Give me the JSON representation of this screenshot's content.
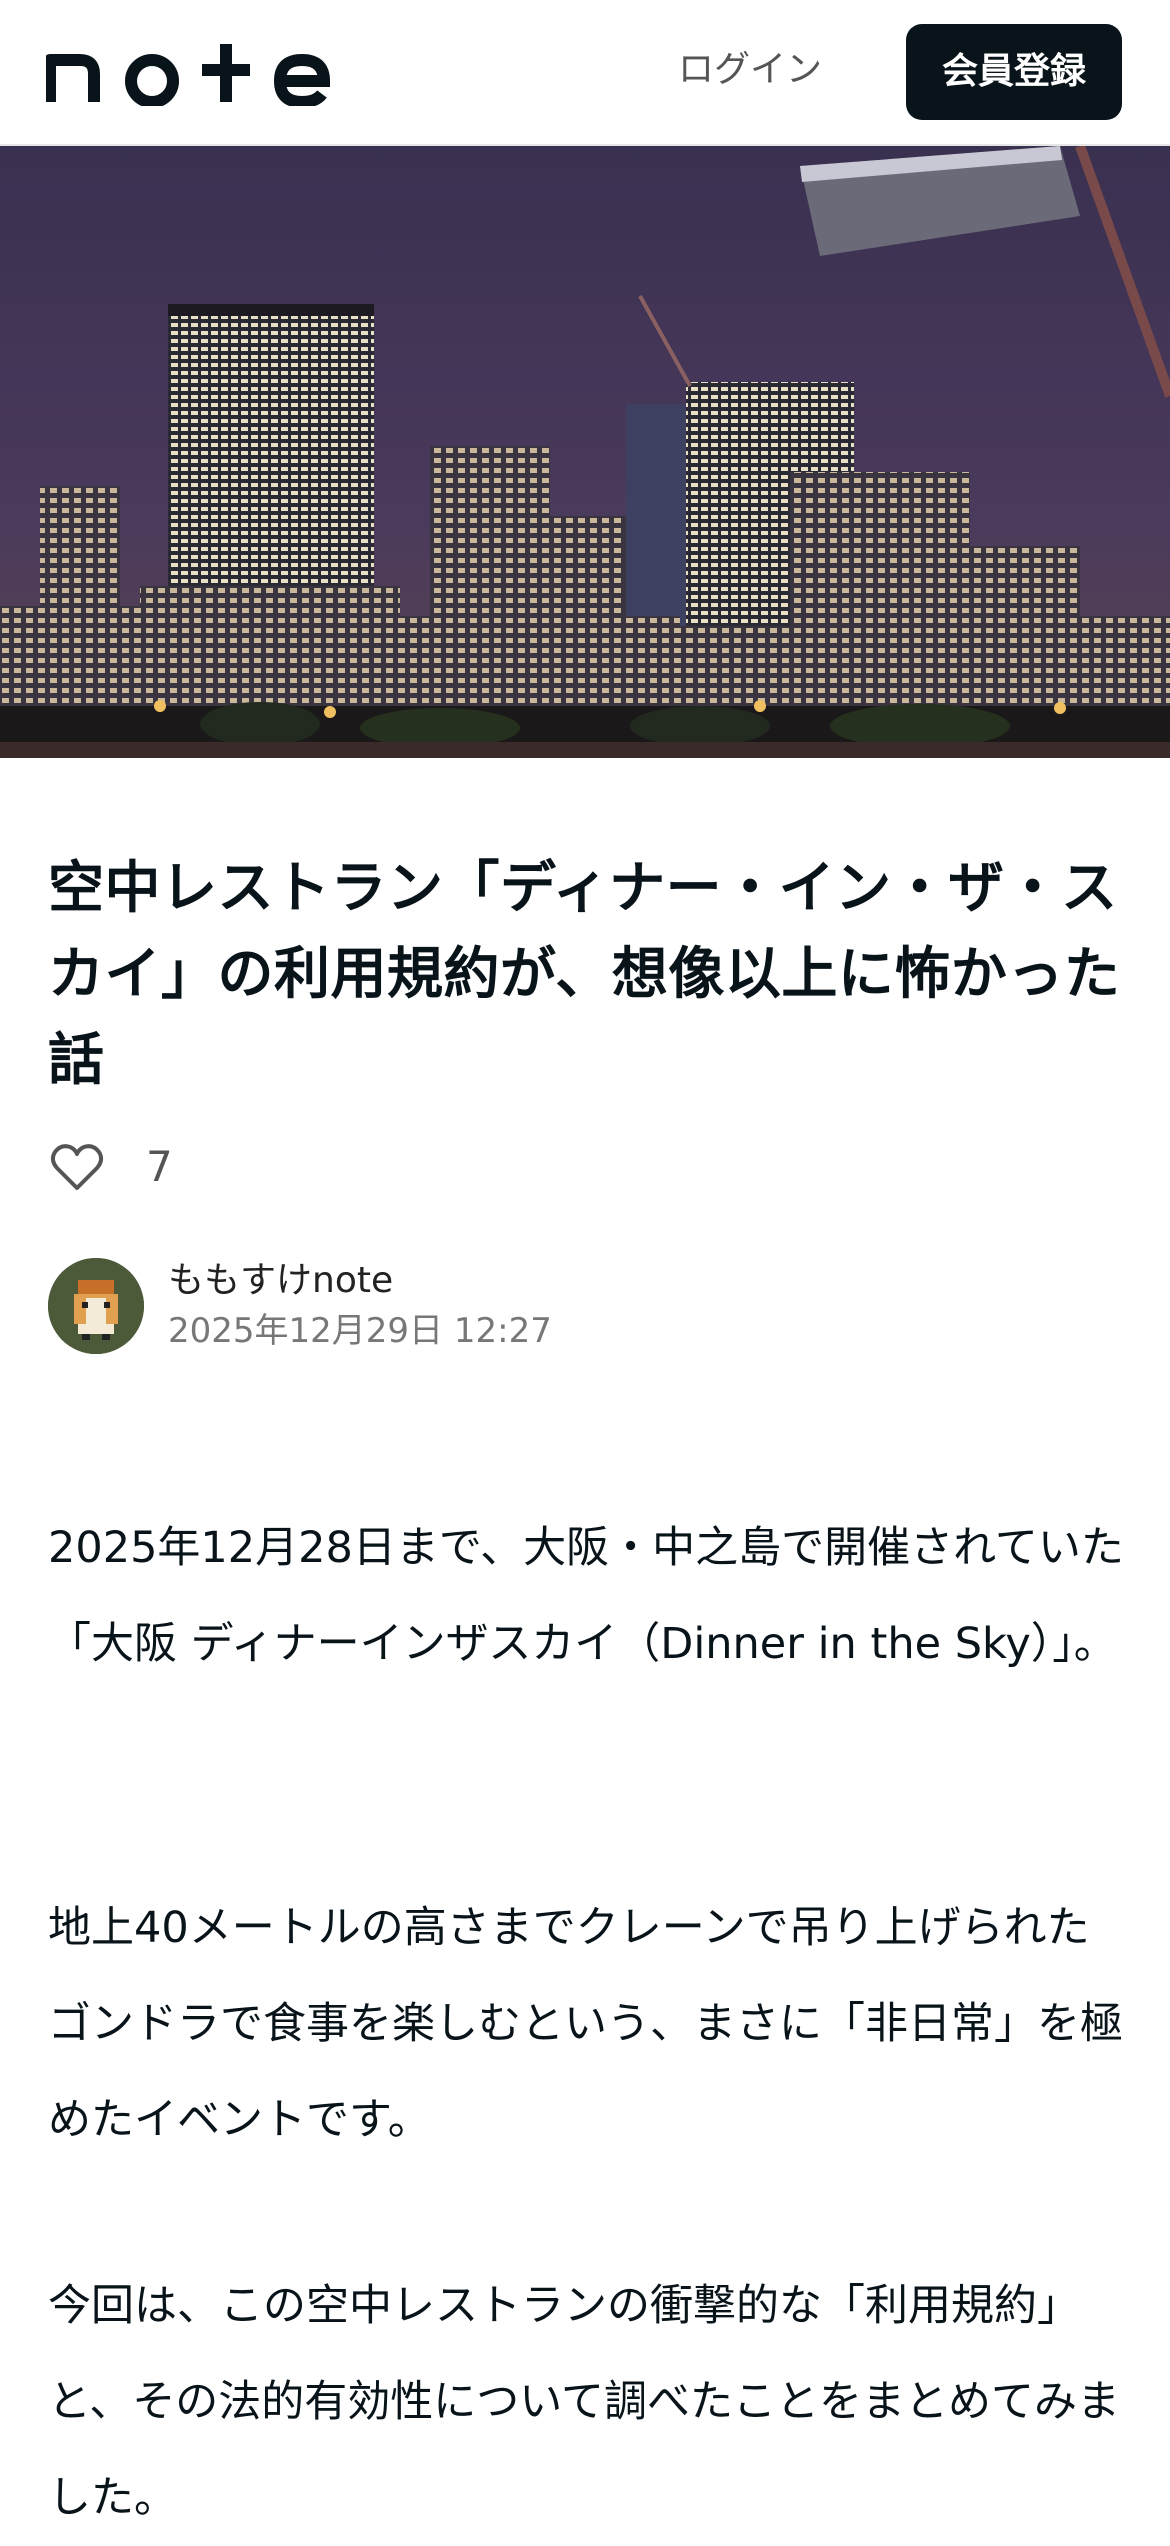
{
  "header": {
    "logo_text": "note",
    "login_label": "ログイン",
    "signup_label": "会員登録"
  },
  "hero": {
    "icon": "city-night-skyline-image"
  },
  "article": {
    "title": "空中レストラン「ディナー・イン・ザ・スカイ」の利用規約が、想像以上に怖かった話",
    "like_count": "7",
    "author_name": "ももすけnote",
    "published_date": "2025年12月29日 12:27",
    "paragraphs": [
      "2025年12月28日まで、大阪・中之島で開催されていた「大阪 ディナーインザスカイ（Dinner in the Sky）」。",
      "地上40メートルの高さまでクレーンで吊り上げられたゴンドラで食事を楽しむという、まさに「非日常」を極めたイベントです。",
      "今回は、この空中レストランの衝撃的な「利用規約」と、その法的有効性について調べたことをまとめてみました。"
    ]
  },
  "colors": {
    "text": "#08131a",
    "signup_bg": "#08131a",
    "muted": "#777777"
  }
}
